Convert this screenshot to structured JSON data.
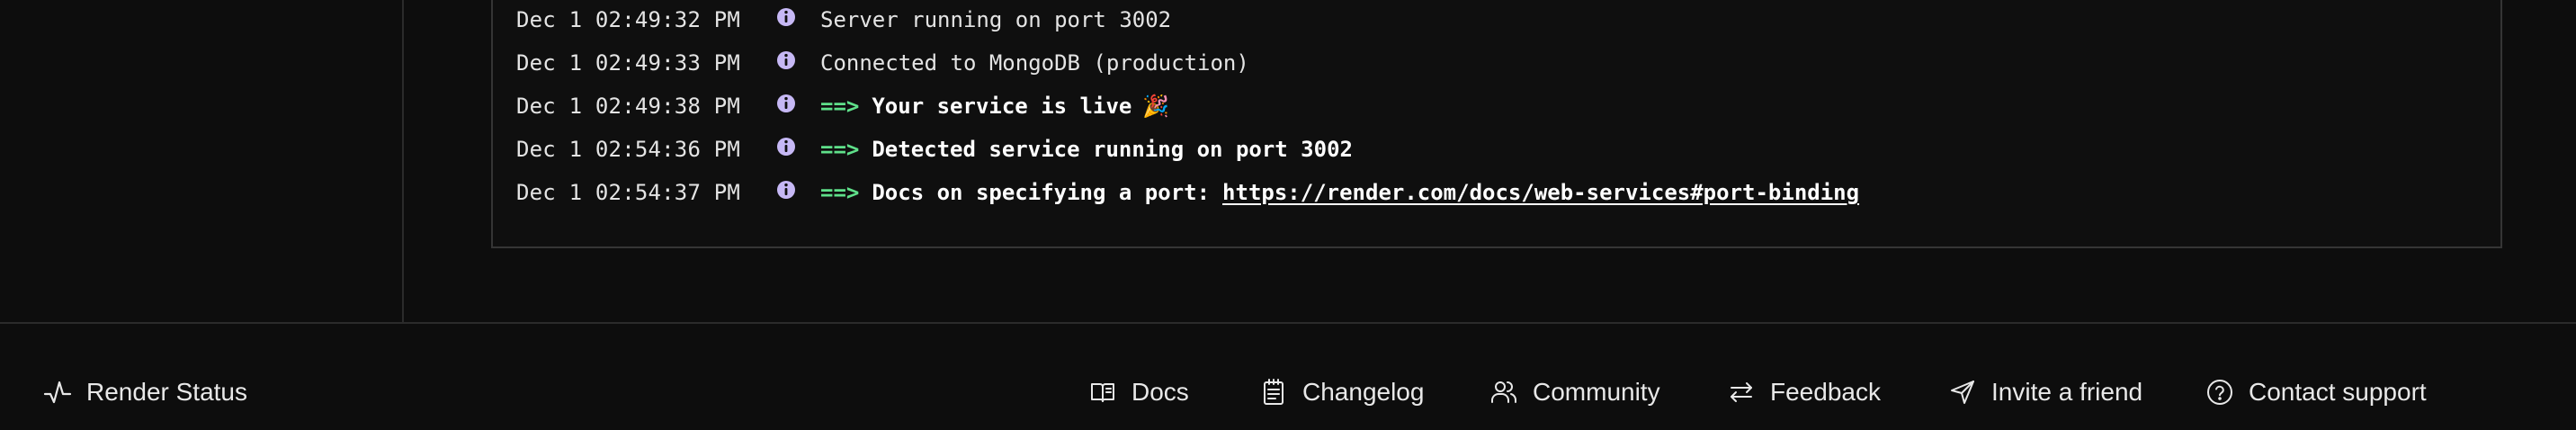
{
  "logs": [
    {
      "timestamp": "Dec 1 02:49:32 PM",
      "level_icon": "info-icon",
      "message": "Server running on port 3002"
    },
    {
      "timestamp": "Dec 1 02:49:33 PM",
      "level_icon": "info-icon",
      "message": "Connected to MongoDB (production)"
    },
    {
      "timestamp": "Dec 1 02:49:38 PM",
      "level_icon": "info-icon",
      "arrow": "==>",
      "message": "Your service is live",
      "emoji": "🎉"
    },
    {
      "timestamp": "Dec 1 02:54:36 PM",
      "level_icon": "info-icon",
      "arrow": "==>",
      "message": "Detected service running on port 3002"
    },
    {
      "timestamp": "Dec 1 02:54:37 PM",
      "level_icon": "info-icon",
      "arrow": "==>",
      "message": "Docs on specifying a port:",
      "link": "https://render.com/docs/web-services#port-binding"
    }
  ],
  "footer": {
    "status": {
      "label": "Render Status",
      "icon": "activity-icon"
    },
    "links": [
      {
        "label": "Docs",
        "icon": "book-icon"
      },
      {
        "label": "Changelog",
        "icon": "notepad-icon"
      },
      {
        "label": "Community",
        "icon": "users-icon"
      },
      {
        "label": "Feedback",
        "icon": "arrows-swap-icon"
      },
      {
        "label": "Invite a friend",
        "icon": "send-icon"
      },
      {
        "label": "Contact support",
        "icon": "help-circle-icon"
      }
    ]
  },
  "colors": {
    "background": "#0d0d0d",
    "info_icon": "#c6b8f5",
    "arrow": "#5fe08a",
    "border": "#353535"
  }
}
